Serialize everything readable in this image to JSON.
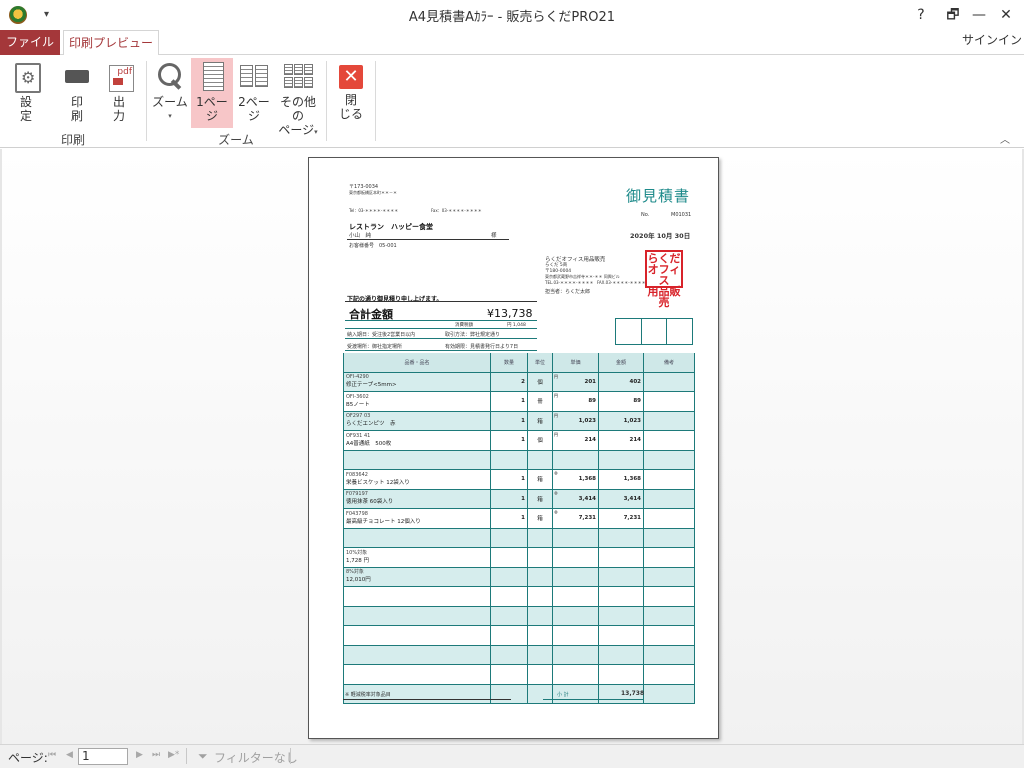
{
  "titlebar": {
    "title": "A4見積書Aｶﾗｰ - 販売らくだPRO21",
    "help": "?",
    "restore": "🗗",
    "minimize": "—",
    "maximize": "☐",
    "close": "✕"
  },
  "tabs": {
    "file": "ファイル",
    "print_preview": "印刷プレビュー",
    "signin": "サインイン"
  },
  "ribbon": {
    "groups": {
      "print": "印刷",
      "zoom": "ズーム"
    },
    "settings": {
      "line1": "設",
      "line2": "定"
    },
    "print": {
      "line1": "印",
      "line2": "刷"
    },
    "output": {
      "line1": "出",
      "line2": "力"
    },
    "zoom": {
      "line1": "ズーム",
      "caret": "▾"
    },
    "one_page": {
      "line1": "1ペー",
      "line2": "ジ"
    },
    "two_page": {
      "line1": "2ペー",
      "line2": "ジ"
    },
    "other_pages": {
      "line1": "その他の",
      "line2": "ページ",
      "caret": "▾"
    },
    "close": {
      "line1": "閉",
      "line2": "じる"
    },
    "collapse": "︿"
  },
  "document": {
    "postal": "〒173-0034",
    "address": "東京都板橋区本町＊＊－＊",
    "tel": "Tel：03-＊＊＊＊-＊＊＊＊",
    "fax": "Fax：03-＊＊＊＊-＊＊＊＊",
    "title": "御見積書",
    "no_label": "No.",
    "no_value": "M01031",
    "customer": "レストラン　ハッピー食堂",
    "contact": "小山　純",
    "honorific": "様",
    "customer_code": "お客様番号　05-001",
    "date": "2020年 10月 30日",
    "company": {
      "name": "らくだオフィス用品販売",
      "sub": "らくだ 5商",
      "postal": "〒180-0004",
      "address": "東京都武蔵野市吉祥寺＊＊-＊＊ 同興ビル",
      "tel": "TEL.03-＊＊＊＊-＊＊＊＊",
      "fax": "FAX.03-＊＊＊＊-＊＊＊＊",
      "person": "担当者：らくだ太郎"
    },
    "stamp": "らくだオフィス用品販売",
    "intro": "下記の通り御見積り申し上げます。",
    "total_label": "合計金額",
    "total_value": "¥13,738",
    "tax_label": "消費税額",
    "tax_value": "円 1,048",
    "delivery": "納入期日：受注後2営業日以内",
    "payment": "取引方法：弊社規定通り",
    "place": "受渡場所：御社指定場所",
    "validity": "有効期限：見積書発行日より7日",
    "headers": [
      "品番・品名",
      "数量",
      "単位",
      "単価",
      "金額",
      "備考"
    ],
    "items": [
      {
        "code": "OFI-4290",
        "name": "修正テープ<5mm>",
        "qty": "2",
        "unit": "個",
        "yen": "円",
        "price": "201",
        "amount": "402"
      },
      {
        "code": "OFI-3602",
        "name": "B5ノート",
        "qty": "1",
        "unit": "冊",
        "yen": "円",
        "price": "89",
        "amount": "89"
      },
      {
        "code": "OF297 03",
        "name": "らくだエンピツ　赤",
        "qty": "1",
        "unit": "箱",
        "yen": "円",
        "price": "1,023",
        "amount": "1,023"
      },
      {
        "code": "OF931 41",
        "name": "A4普通紙　500枚",
        "qty": "1",
        "unit": "個",
        "yen": "円",
        "price": "214",
        "amount": "214"
      },
      {
        "code": "",
        "name": "",
        "qty": "",
        "unit": "",
        "yen": "",
        "price": "",
        "amount": ""
      },
      {
        "code": "F083642",
        "name": "栄養ビスケット 12袋入り",
        "qty": "1",
        "unit": "箱",
        "yen": "※",
        "price": "1,368",
        "amount": "1,368"
      },
      {
        "code": "F079197",
        "name": "徳用抹茶 60袋入り",
        "qty": "1",
        "unit": "箱",
        "yen": "※",
        "price": "3,414",
        "amount": "3,414"
      },
      {
        "code": "F043798",
        "name": "最高級チョコレート 12個入り",
        "qty": "1",
        "unit": "箱",
        "yen": "※",
        "price": "7,231",
        "amount": "7,231"
      },
      {
        "code": "",
        "name": "",
        "qty": "",
        "unit": "",
        "yen": "",
        "price": "",
        "amount": ""
      },
      {
        "code": "10%対象",
        "name": "1,728 円",
        "qty": "",
        "unit": "",
        "yen": "",
        "price": "",
        "amount": ""
      },
      {
        "code": "8%対象",
        "name": "12,010円",
        "qty": "",
        "unit": "",
        "yen": "",
        "price": "",
        "amount": ""
      },
      {
        "code": "",
        "name": "",
        "qty": "",
        "unit": "",
        "yen": "",
        "price": "",
        "amount": ""
      },
      {
        "code": "",
        "name": "",
        "qty": "",
        "unit": "",
        "yen": "",
        "price": "",
        "amount": ""
      },
      {
        "code": "",
        "name": "",
        "qty": "",
        "unit": "",
        "yen": "",
        "price": "",
        "amount": ""
      },
      {
        "code": "",
        "name": "",
        "qty": "",
        "unit": "",
        "yen": "",
        "price": "",
        "amount": ""
      },
      {
        "code": "",
        "name": "",
        "qty": "",
        "unit": "",
        "yen": "",
        "price": "",
        "amount": ""
      },
      {
        "code": "",
        "name": "",
        "qty": "",
        "unit": "",
        "yen": "",
        "price": "",
        "amount": ""
      }
    ],
    "reduced_note": "※ 軽減税率対象品目",
    "subtotal_label": "小 計",
    "subtotal_value": "13,738"
  },
  "statusbar": {
    "page_label": "ページ:",
    "first": "⏮",
    "prev": "◀",
    "page_value": "1",
    "next": "▶",
    "last": "⏭",
    "new": "▶*",
    "filter": "フィルターなし"
  }
}
